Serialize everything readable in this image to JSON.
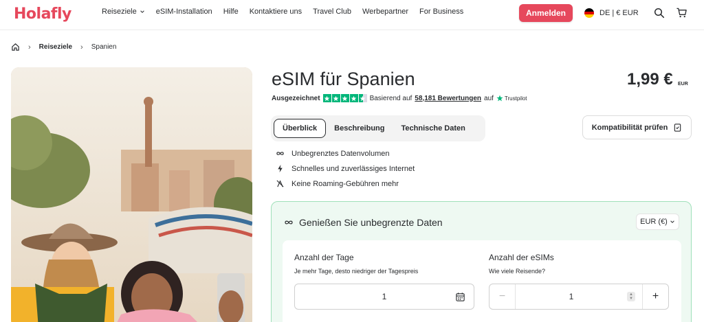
{
  "brand": {
    "logo_text": "Holafly",
    "accent": "#e6485c"
  },
  "nav": {
    "items": [
      {
        "label": "Reiseziele",
        "has_dropdown": true
      },
      {
        "label": "eSIM-Installation"
      },
      {
        "label": "Hilfe"
      },
      {
        "label": "Kontaktiere uns"
      },
      {
        "label": "Travel Club"
      },
      {
        "label": "Werbepartner"
      },
      {
        "label": "For Business"
      }
    ],
    "login_label": "Anmelden",
    "locale_label": "DE | € EUR",
    "icons": [
      "search-icon",
      "cart-icon"
    ]
  },
  "breadcrumb": {
    "home_icon": "home-icon",
    "items": [
      "Reiseziele",
      "Spanien"
    ]
  },
  "product": {
    "title": "eSIM für Spanien",
    "price": "1,99 €",
    "currency": "EUR",
    "rating": {
      "label": "Ausgezeichnet",
      "stars": 4.5,
      "based_on": "Basierend auf",
      "count": "58,181 Bewertungen",
      "on": "auf",
      "provider": "Trustpilot"
    },
    "tabs": [
      "Überblick",
      "Beschreibung",
      "Technische Daten"
    ],
    "active_tab": "Überblick",
    "compatibility_button": "Kompatibilität prüfen",
    "features": [
      {
        "icon": "infinity-icon",
        "label": "Unbegrenztes Datenvolumen"
      },
      {
        "icon": "lightning-icon",
        "label": "Schnelles und zuverlässiges Internet"
      },
      {
        "icon": "no-roaming-icon",
        "label": "Keine Roaming-Gebühren mehr"
      }
    ]
  },
  "plan": {
    "heading": "Genießen Sie unbegrenzte Daten",
    "currency_select": "EUR (€)",
    "days": {
      "title": "Anzahl der Tage",
      "subtitle": "Je mehr Tage, desto niedriger der Tagespreis",
      "value": "1"
    },
    "esims": {
      "title": "Anzahl der eSIMs",
      "subtitle": "Wie viele Reisende?",
      "value": "1",
      "minus": "−",
      "plus": "+"
    }
  }
}
